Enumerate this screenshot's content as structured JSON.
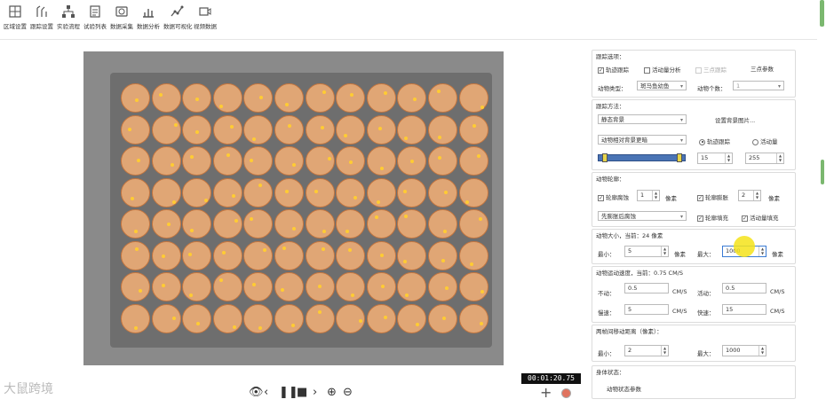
{
  "toolbar": {
    "items": [
      {
        "label": "区域设置",
        "icon": "region-icon"
      },
      {
        "label": "跟踪设置",
        "icon": "tracking-icon"
      },
      {
        "label": "实验流程",
        "icon": "flow-icon"
      },
      {
        "label": "试验列表",
        "icon": "list-icon"
      },
      {
        "label": "数据采集",
        "icon": "camera-icon"
      },
      {
        "label": "数据分析",
        "icon": "chart-icon"
      },
      {
        "label": "数据可视化",
        "icon": "visualize-icon"
      },
      {
        "label": "视频数据",
        "icon": "video-icon"
      }
    ]
  },
  "player": {
    "timecode": "00:01:20.75",
    "logo": "大鼠跨境"
  },
  "panel": {
    "tracking_options": {
      "title": "跟踪选项：",
      "trajectory_label": "轨迹跟踪",
      "activity_label": "活动量分析",
      "three_point_label": "三点跟踪",
      "three_point_params": "三点参数",
      "animal_type_label": "动物类型：",
      "animal_type_value": "斑马鱼幼鱼",
      "animal_count_label": "动物个数：",
      "animal_count_value": "1"
    },
    "tracking_method": {
      "title": "跟踪方法：",
      "background_mode": "静态背景",
      "set_background_label": "设置背景图片...",
      "contrast_mode": "动物相对背景更暗",
      "trajectory_radio": "轨迹跟踪",
      "activity_radio": "活动量",
      "range_min": "15",
      "range_max": "255"
    },
    "contour": {
      "title": "动物轮廓：",
      "erode_label": "轮廓腐蚀",
      "erode_value": "1",
      "dilate_label": "轮廓膨胀",
      "dilate_value": "2",
      "unit": "像素",
      "order_mode": "先膨胀后腐蚀",
      "fill_label": "轮廓填充",
      "activity_fill_label": "活动量填充"
    },
    "size": {
      "title": "动物大小，当前：24 像素",
      "min_label": "最小：",
      "min_value": "5",
      "max_label": "最大：",
      "max_value": "1000",
      "unit": "像素"
    },
    "speed": {
      "title": "动物运动速度，当前：0.75 CM/S",
      "still_label": "不动：",
      "still_value": "0.5",
      "active_label": "活动：",
      "active_value": "0.5",
      "slow_label": "慢速：",
      "slow_value": "5",
      "fast_label": "快速：",
      "fast_value": "15",
      "unit": "CM/S"
    },
    "frame_distance": {
      "title": "两帧间移动距离（像素）：",
      "min_label": "最小：",
      "min_value": "2",
      "max_label": "最大：",
      "max_value": "1000"
    },
    "body_state": {
      "title": "身体状态：",
      "params_label": "动物状态参数"
    }
  },
  "colors": {
    "well_fill": "#e0a675",
    "well_border": "#c5763f",
    "slider_blue": "#4a74b5",
    "highlight": "#f5e31a"
  }
}
